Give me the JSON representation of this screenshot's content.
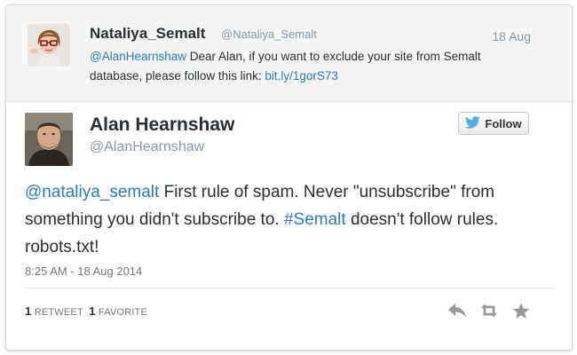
{
  "parent_tweet": {
    "name": "Nataliya_Semalt",
    "handle": "@Nataliya_Semalt",
    "time": "18 Aug",
    "mention": "@AlanHearnshaw",
    "text": " Dear Alan, if you want to exclude your site from Semalt database, please follow this link: ",
    "link": "bit.ly/1gorS73"
  },
  "main_tweet": {
    "name": "Alan Hearnshaw",
    "handle": "@AlanHearnshaw",
    "follow_label": "Follow",
    "mention": "@nataliya_semalt",
    "text_1": " First rule of spam. Never \"unsubscribe\" from something you didn't subscribe to. ",
    "hashtag": "#Semalt",
    "text_2": " doesn't follow rules. robots.txt!",
    "timestamp": "8:25 AM - 18 Aug 2014",
    "retweets_count": "1",
    "retweets_label": "RETWEET",
    "favorites_count": "1",
    "favorites_label": "FAVORITE"
  },
  "icons": {
    "follow": "twitter-bird-icon",
    "reply": "reply-icon",
    "retweet": "retweet-icon",
    "favorite": "star-icon"
  },
  "colors": {
    "link": "#2b7bb9",
    "twitter_blue": "#55acee",
    "muted": "#8899a6",
    "action_gray": "#999999"
  }
}
